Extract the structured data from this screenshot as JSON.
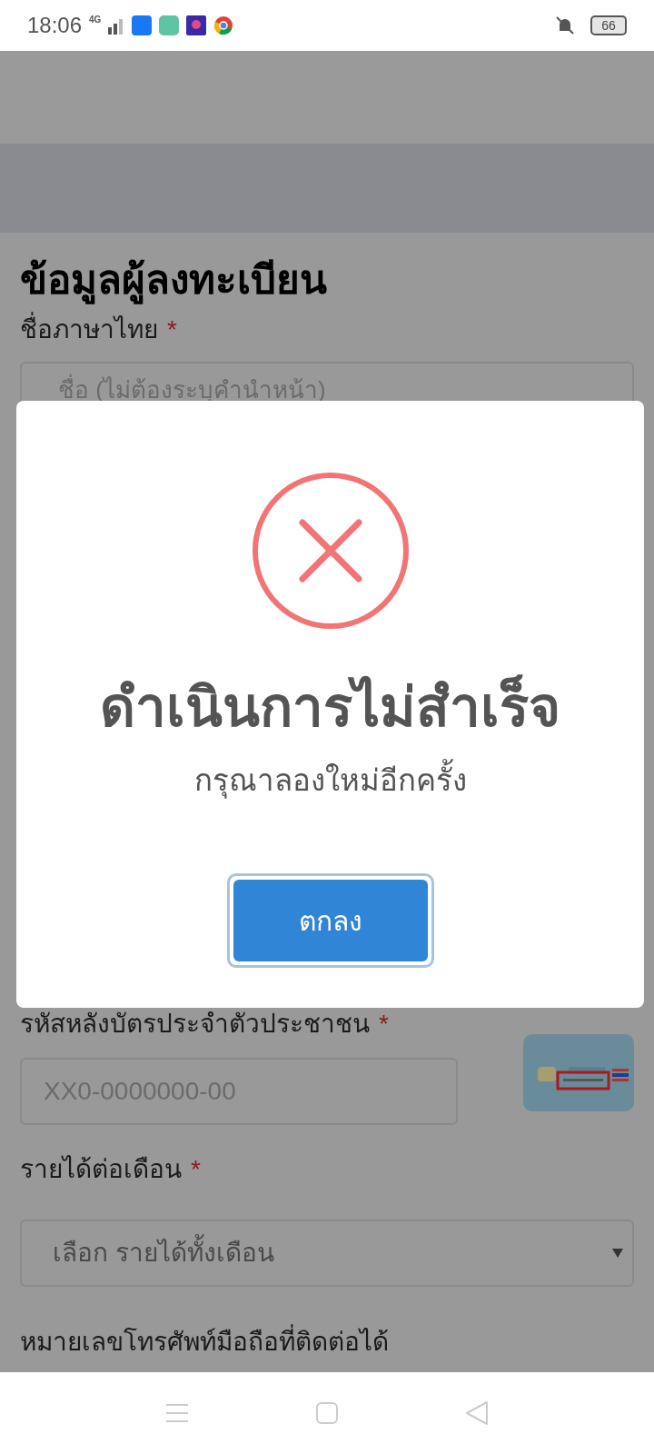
{
  "status_bar": {
    "time": "18:06",
    "network": "4G",
    "battery": "66"
  },
  "form": {
    "title": "ข้อมูลผู้ลงทะเบียน",
    "fields": [
      {
        "kind": "text",
        "label": "ชื่อภาษาไทย",
        "required_mark": "*",
        "placeholder": "ชื่อ (ไม่ต้องระบุคำนำหน้า)"
      },
      {
        "kind": "card",
        "label": "รหัสหลังบัตรประจำตัวประชาชน",
        "required_mark": "*",
        "placeholder": "XX0-0000000-00"
      },
      {
        "kind": "select",
        "label": "รายได้ต่อเดือน",
        "required_mark": "*",
        "placeholder": "เลือก รายได้ทั้งเดือน"
      },
      {
        "kind": "label",
        "label": "หมายเลขโทรศัพท์มือถือที่ติดต่อได้"
      }
    ]
  },
  "dialog": {
    "title": "ดำเนินการไม่สำเร็จ",
    "message": "กรุณาลองใหม่อีกครั้ง",
    "button": "ตกลง"
  }
}
